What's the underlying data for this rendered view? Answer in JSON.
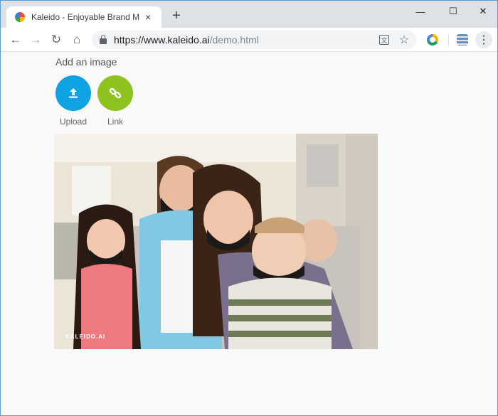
{
  "browser": {
    "tab_title": "Kaleido - Enjoyable Brand Mark",
    "tab_close_icon": "×",
    "new_tab_icon": "+",
    "minimize_icon": "—",
    "maximize_icon": "☐",
    "close_icon": "✕",
    "back_icon": "←",
    "forward_icon": "→",
    "reload_icon": "↻",
    "home_icon": "⌂",
    "url_base": "https://www.kaleido.ai",
    "url_path": "/demo.html",
    "translate_icon": "文",
    "star_icon": "☆",
    "menu_icon": "⋮"
  },
  "page": {
    "heading": "Add an image",
    "upload_label": "Upload",
    "link_label": "Link",
    "watermark": "KALEIDO.AI"
  },
  "colors": {
    "upload_button": "#0fa3e4",
    "link_button": "#8dc21f"
  }
}
